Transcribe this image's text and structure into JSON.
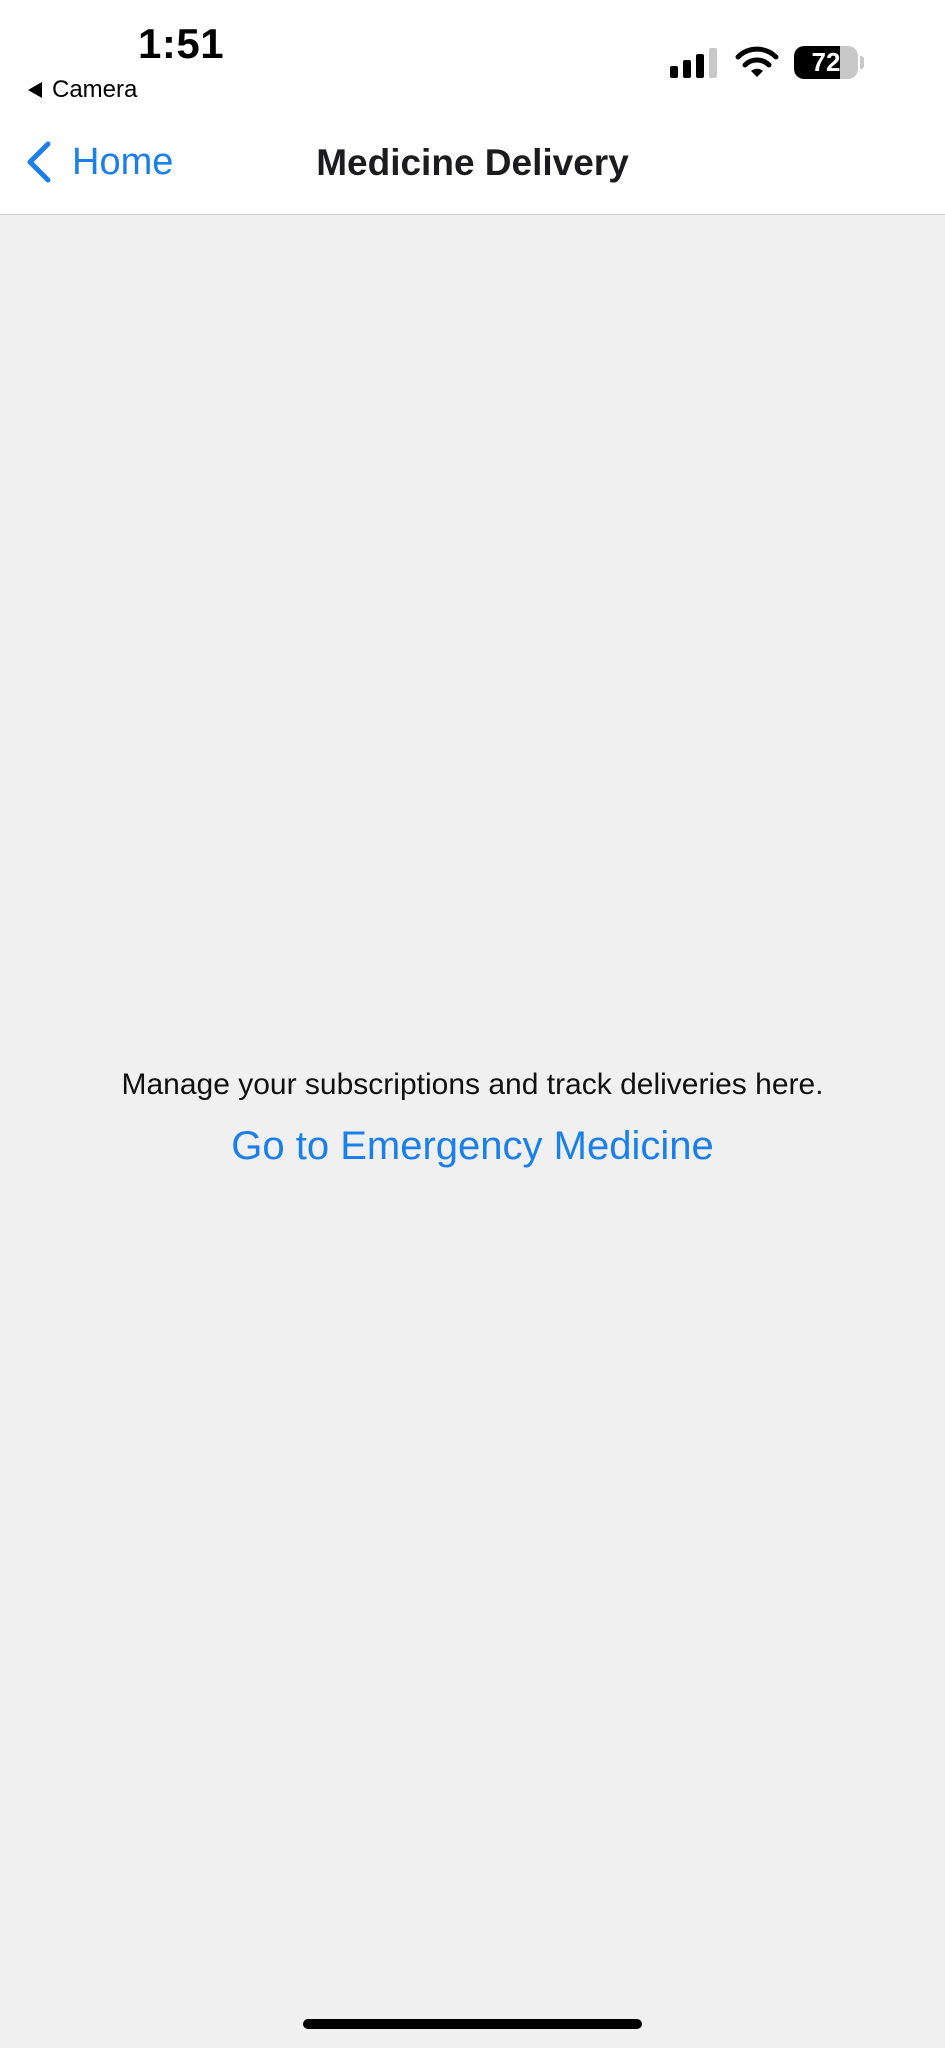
{
  "status_bar": {
    "time": "1:51",
    "back_app_label": "Camera",
    "battery_percent": "72",
    "battery_level": 0.72
  },
  "nav": {
    "back_label": "Home",
    "title": "Medicine Delivery"
  },
  "main": {
    "subtitle": "Manage your subscriptions and track deliveries here.",
    "link_label": "Go to Emergency Medicine"
  },
  "colors": {
    "accent": "#1a7fe8",
    "background": "#f0f0f0",
    "bar_background": "#ffffff"
  },
  "icons": {
    "back_app": "back-triangle-icon",
    "signal": "cellular-signal-icon",
    "wifi": "wifi-icon",
    "battery": "battery-icon",
    "nav_back": "chevron-left-icon"
  }
}
